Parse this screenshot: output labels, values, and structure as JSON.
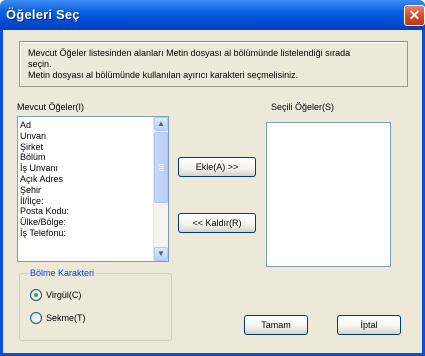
{
  "window": {
    "title": "Öğeleri Seç",
    "close_glyph": "✕"
  },
  "info": {
    "line1": "Mevcut Öğeler listesinden alanları Metin dosyası al bölümünde listelendiği sırada",
    "line2": "seçin.",
    "line3": "Metin dosyası al bölümünde kullanılan ayırıcı karakteri seçmelisiniz."
  },
  "available": {
    "label": "Mevcut Öğeler(I)",
    "items": [
      "Ad",
      "Unvan",
      "Şirket",
      "Bölüm",
      "İş Unvanı",
      "Açık Adres",
      "Şehir",
      "İl/İlçe:",
      "Posta Kodu:",
      "Ülke/Bölge:",
      "İş Telefonu:"
    ]
  },
  "selected": {
    "label": "Seçili Öğeler(S)",
    "items": []
  },
  "buttons": {
    "add": "Ekle(A) >>",
    "remove": "<< Kaldır(R)",
    "ok": "Tamam",
    "cancel": "İptal"
  },
  "separator": {
    "title": "Bölme Karakteri",
    "options": [
      {
        "label": "Virgül(C)",
        "selected": true
      },
      {
        "label": "Sekme(T)",
        "selected": false
      }
    ]
  },
  "icons": {
    "scroll_up": "up-arrow-icon",
    "scroll_down": "down-arrow-icon",
    "close": "close-icon"
  },
  "colors": {
    "title_bar": "#0054e3",
    "face": "#ece9d8",
    "group_title": "#0046d5",
    "radio_dot": "#3ea83e"
  }
}
